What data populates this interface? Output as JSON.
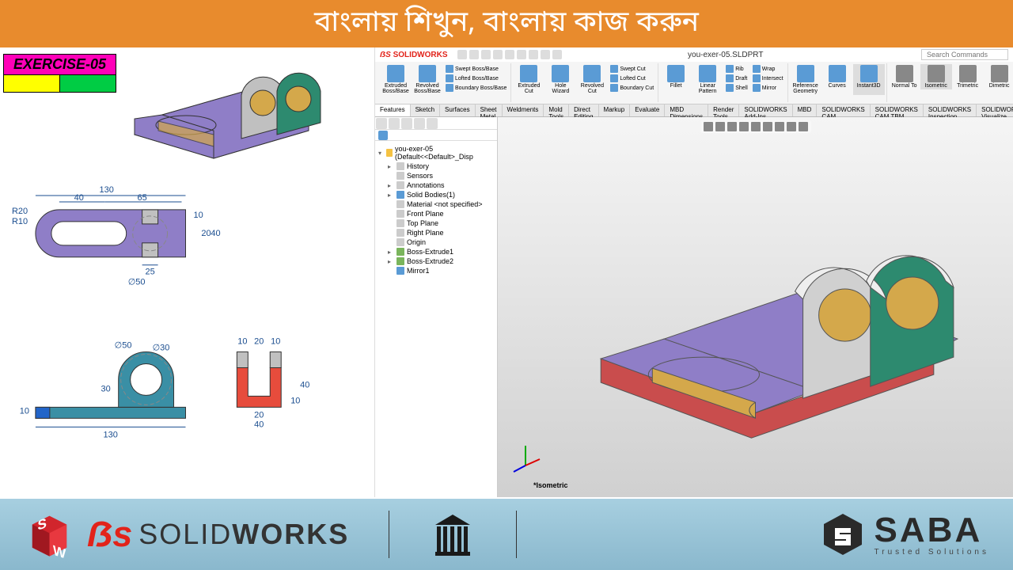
{
  "header_text": "বাংলায় শিখুন, বাংলায় কাজ করুন",
  "exercise_label": "EXERCISE-05",
  "dimensions": {
    "top_width": "130",
    "top_left": "40",
    "top_mid": "65",
    "r20": "R20",
    "r10": "R10",
    "right_10": "10",
    "right_20": "20",
    "right_40": "40",
    "bottom_25": "25",
    "bottom_d50": "∅50",
    "side_130": "130",
    "side_10": "10",
    "side_d50": "∅50",
    "side_d30": "∅30",
    "side_30": "30",
    "red_10a": "10",
    "red_20": "20",
    "red_10b": "10",
    "red_h10": "10",
    "red_h40": "40",
    "red_b20": "20",
    "red_b40": "40"
  },
  "solidworks": {
    "app_name": "SOLIDWORKS",
    "filename": "you-exer-05.SLDPRT",
    "search_placeholder": "Search Commands",
    "ribbon": {
      "extruded_boss": "Extruded Boss/Base",
      "revolved_boss": "Revolved Boss/Base",
      "swept_boss": "Swept Boss/Base",
      "lofted_boss": "Lofted Boss/Base",
      "boundary_boss": "Boundary Boss/Base",
      "extruded_cut": "Extruded Cut",
      "hole_wizard": "Hole Wizard",
      "revolved_cut": "Revolved Cut",
      "swept_cut": "Swept Cut",
      "lofted_cut": "Lofted Cut",
      "boundary_cut": "Boundary Cut",
      "fillet": "Fillet",
      "linear_pattern": "Linear Pattern",
      "rib": "Rib",
      "draft": "Draft",
      "shell": "Shell",
      "wrap": "Wrap",
      "intersect": "Intersect",
      "mirror": "Mirror",
      "ref_geometry": "Reference Geometry",
      "curves": "Curves",
      "instant3d": "Instant3D",
      "normal_to": "Normal To",
      "isometric": "Isometric",
      "trimetric": "Trimetric",
      "dimetric": "Dimetric"
    },
    "tabs": [
      "Features",
      "Sketch",
      "Surfaces",
      "Sheet Metal",
      "Weldments",
      "Mold Tools",
      "Direct Editing",
      "Markup",
      "Evaluate",
      "MBD Dimensions",
      "Render Tools",
      "SOLIDWORKS Add-Ins",
      "MBD",
      "SOLIDWORKS CAM",
      "SOLIDWORKS CAM TBM",
      "SOLIDWORKS Inspection",
      "SOLIDWORKS Visualize"
    ],
    "tree": {
      "root": "you-exer-05 (Default<<Default>_Disp",
      "history": "History",
      "sensors": "Sensors",
      "annotations": "Annotations",
      "solid_bodies": "Solid Bodies(1)",
      "material": "Material <not specified>",
      "front_plane": "Front Plane",
      "top_plane": "Top Plane",
      "right_plane": "Right Plane",
      "origin": "Origin",
      "boss1": "Boss-Extrude1",
      "boss2": "Boss-Extrude2",
      "mirror1": "Mirror1"
    },
    "viewport_label": "*Isometric"
  },
  "footer": {
    "solid": "SOLID",
    "works": "WORKS",
    "saba": "SABA",
    "saba_tagline": "Trusted Solutions"
  }
}
